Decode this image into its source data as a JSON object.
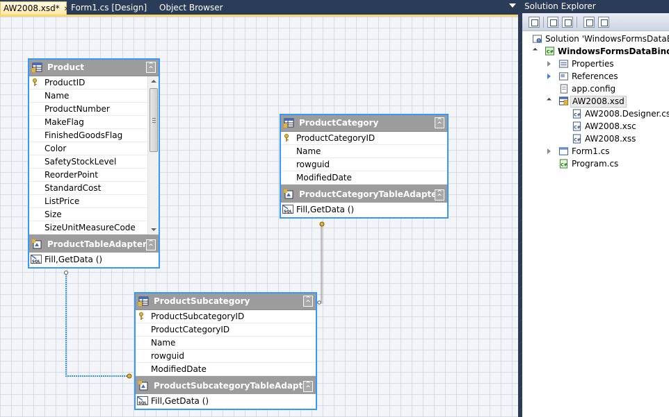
{
  "tabs": [
    {
      "label": "AW2008.xsd*",
      "active": true
    },
    {
      "label": "Form1.cs [Design]",
      "active": false
    },
    {
      "label": "Object Browser",
      "active": false
    }
  ],
  "tables": {
    "product": {
      "title": "Product",
      "columns": [
        "ProductID",
        "Name",
        "ProductNumber",
        "MakeFlag",
        "FinishedGoodsFlag",
        "Color",
        "SafetyStockLevel",
        "ReorderPoint",
        "StandardCost",
        "ListPrice",
        "Size",
        "SizeUnitMeasureCode"
      ],
      "adapter": "ProductTableAdapter",
      "query": "Fill,GetData ()"
    },
    "category": {
      "title": "ProductCategory",
      "columns": [
        "ProductCategoryID",
        "Name",
        "rowguid",
        "ModifiedDate"
      ],
      "adapter": "ProductCategoryTableAdapter",
      "query": "Fill,GetData ()"
    },
    "subcategory": {
      "title": "ProductSubcategory",
      "columns": [
        "ProductSubcategoryID",
        "ProductCategoryID",
        "Name",
        "rowguid",
        "ModifiedDate"
      ],
      "adapter": "ProductSubcategoryTableAdapter",
      "query": "Fill,GetData ()"
    }
  },
  "solution_explorer": {
    "title": "Solution Explorer",
    "nodes": [
      {
        "label": "Solution 'WindowsFormsDataBinding",
        "icon": "solution-icon"
      },
      {
        "label": "WindowsFormsDataBinding",
        "icon": "csharp-project-icon"
      },
      {
        "label": "Properties",
        "icon": "properties-icon"
      },
      {
        "label": "References",
        "icon": "references-icon"
      },
      {
        "label": "app.config",
        "icon": "config-file-icon"
      },
      {
        "label": "AW2008.xsd",
        "icon": "dataset-icon"
      },
      {
        "label": "AW2008.Designer.cs",
        "icon": "cs-file-icon"
      },
      {
        "label": "AW2008.xsc",
        "icon": "cs-file-icon"
      },
      {
        "label": "AW2008.xss",
        "icon": "cs-file-icon"
      },
      {
        "label": "Form1.cs",
        "icon": "form-icon"
      },
      {
        "label": "Program.cs",
        "icon": "cs-program-icon"
      }
    ]
  },
  "colors": {
    "chrome": "#2b3c59",
    "selection_border": "#3399ff",
    "header_gray": "#9c9c9c",
    "active_tab": "#ffe8a6"
  }
}
